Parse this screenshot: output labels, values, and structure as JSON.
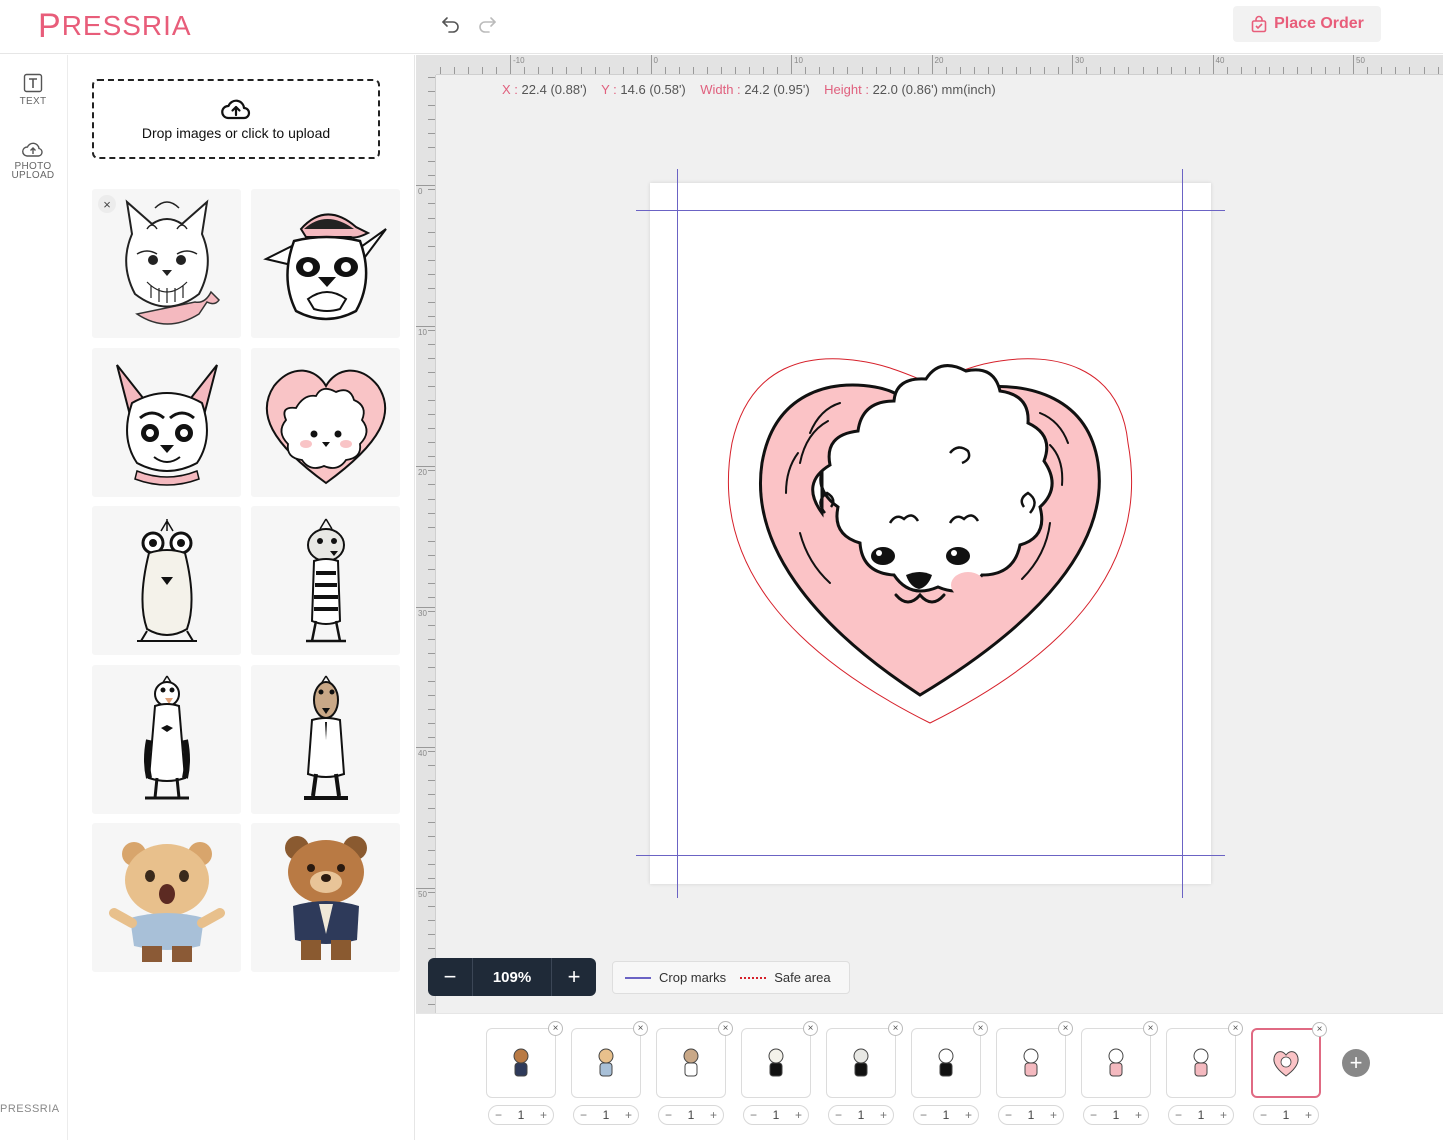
{
  "header": {
    "logo_p": "P",
    "logo_text": "RESSRIA",
    "place_order_label": "Place Order"
  },
  "rail": {
    "text_label": "TEXT",
    "photo_label_1": "PHOTO",
    "photo_label_2": "UPLOAD",
    "footer_brand": "PRESSRIA"
  },
  "panel": {
    "upload_text": "Drop images or click to upload",
    "thumbs": [
      "yorkie-dog",
      "bulldog-cap",
      "chihuahua-collar",
      "poodle-heart",
      "glasses-dog",
      "zebra-dog",
      "tuxedo-dog",
      "suit-dog",
      "shocked-bear",
      "suit-bear"
    ]
  },
  "workspace": {
    "ruler_top_labels": [
      "-10",
      "0",
      "10",
      "20",
      "30",
      "40",
      "50"
    ],
    "ruler_left_labels": [
      "0",
      "10",
      "20",
      "30",
      "40",
      "50"
    ],
    "coords": {
      "x_key": "X :",
      "x_val": "22.4 (0.88')",
      "y_key": "Y :",
      "y_val": "14.6 (0.58')",
      "w_key": "Width :",
      "w_val": "24.2 (0.95')",
      "h_key": "Height :",
      "h_val": "22.0 (0.86') mm(inch)"
    },
    "zoom": {
      "minus": "−",
      "value": "109%",
      "plus": "+"
    },
    "legend": {
      "crop": "Crop marks",
      "safe": "Safe area"
    },
    "colors": {
      "crop": "#6b63c4",
      "safe": "#d6202a",
      "accent": "#e85d7a"
    }
  },
  "strip": {
    "slots": [
      {
        "qty": "1",
        "icon": "suit-bear"
      },
      {
        "qty": "1",
        "icon": "shocked-bear"
      },
      {
        "qty": "1",
        "icon": "suit-dog"
      },
      {
        "qty": "1",
        "icon": "glasses-dog"
      },
      {
        "qty": "1",
        "icon": "zebra-dog"
      },
      {
        "qty": "1",
        "icon": "tuxedo-dog"
      },
      {
        "qty": "1",
        "icon": "yorkie-dog"
      },
      {
        "qty": "1",
        "icon": "bulldog-cap"
      },
      {
        "qty": "1",
        "icon": "chihuahua-collar"
      },
      {
        "qty": "1",
        "icon": "poodle-heart"
      }
    ],
    "minus": "−",
    "plus": "+",
    "remove": "×",
    "add": "+"
  }
}
